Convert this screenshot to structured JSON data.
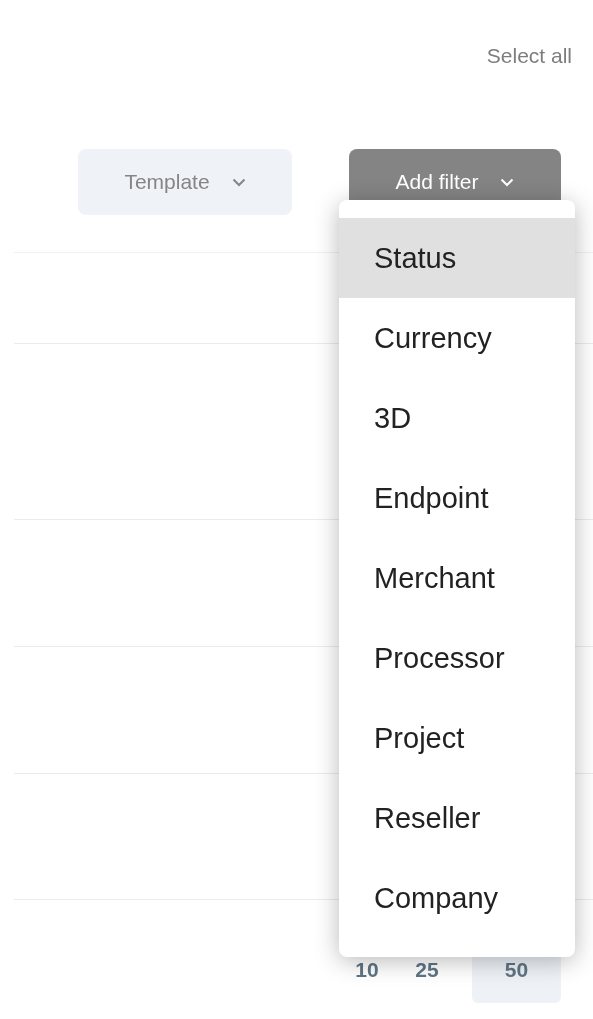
{
  "select_all": "Select all",
  "buttons": [
    {
      "label": "Template",
      "kind": "secondary"
    },
    {
      "label": "Add filter",
      "kind": "primary"
    }
  ],
  "filter_menu": {
    "items": [
      {
        "label": "Status",
        "selected": true
      },
      {
        "label": "Currency",
        "selected": false
      },
      {
        "label": "3D",
        "selected": false
      },
      {
        "label": "Endpoint",
        "selected": false
      },
      {
        "label": "Merchant",
        "selected": false
      },
      {
        "label": "Processor",
        "selected": false
      },
      {
        "label": "Project",
        "selected": false
      },
      {
        "label": "Reseller",
        "selected": false
      },
      {
        "label": "Company",
        "selected": false
      }
    ]
  },
  "page_sizes": [
    {
      "label": "10",
      "selected": false
    },
    {
      "label": "25",
      "selected": false
    },
    {
      "label": "50",
      "selected": true
    }
  ]
}
